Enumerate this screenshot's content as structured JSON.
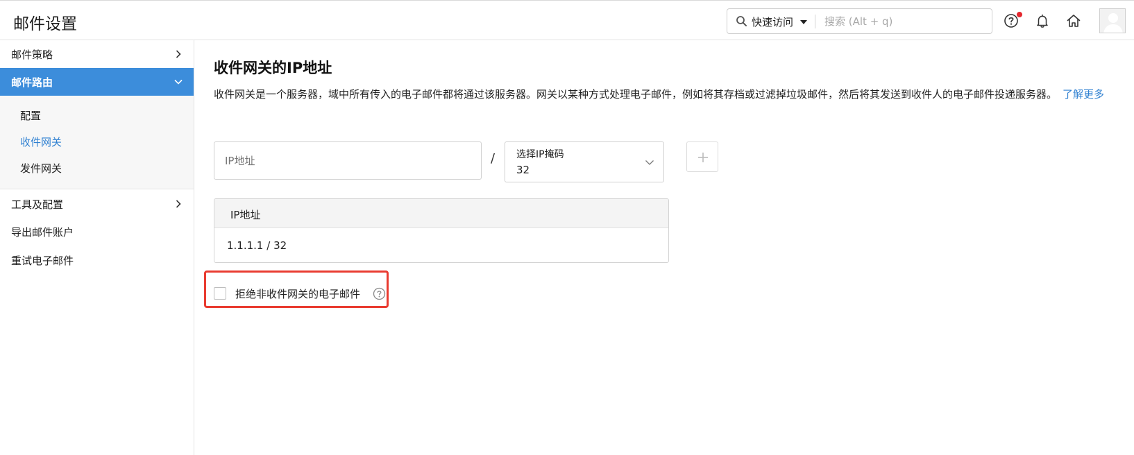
{
  "header": {
    "title": "邮件设置",
    "quick_access": "快速访问",
    "search_placeholder": "搜索 (Alt + q)",
    "icons": [
      "search-icon",
      "help-icon",
      "bell-icon",
      "home-icon",
      "avatar"
    ],
    "notification_dot_color": "#e4262d"
  },
  "sidebar": {
    "items": [
      {
        "label": "邮件策略",
        "icon": "chevron-right-icon"
      },
      {
        "label": "邮件路由",
        "icon": "chevron-down-icon",
        "active": true
      },
      {
        "label": "工具及配置",
        "icon": "chevron-right-icon"
      },
      {
        "label": "导出邮件账户"
      },
      {
        "label": "重试电子邮件"
      }
    ],
    "subitems": [
      {
        "label": "配置"
      },
      {
        "label": "收件网关",
        "current": true
      },
      {
        "label": "发件网关"
      }
    ],
    "active_color": "#3c8ddb"
  },
  "main": {
    "title": "收件网关的IP地址",
    "description": "收件网关是一个服务器，域中所有传入的电子邮件都将通过该服务器。网关以某种方式处理电子邮件，例如将其存档或过滤掉垃圾邮件，然后将其发送到收件人的电子邮件投递服务器。",
    "learn_more": "了解更多",
    "ip_placeholder": "IP地址",
    "slash": "/",
    "mask_label": "选择IP掩码",
    "mask_value": "32",
    "table": {
      "header": "IP地址",
      "rows": [
        "1.1.1.1 / 32"
      ]
    },
    "reject_checkbox": {
      "label": "拒绝非收件网关的电子邮件",
      "checked": false
    },
    "link_color": "#2f80d1"
  }
}
